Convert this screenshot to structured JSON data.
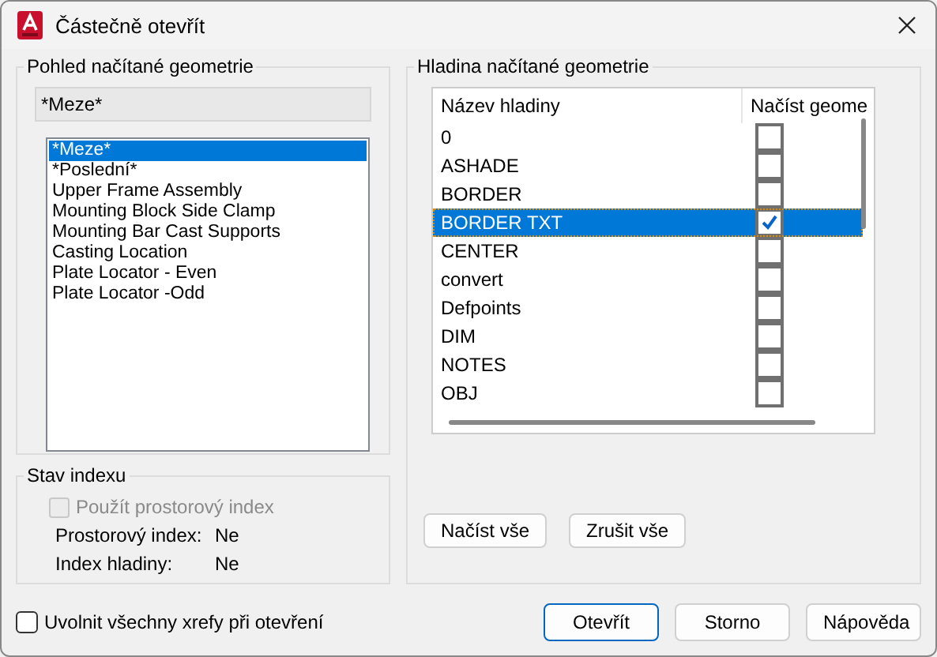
{
  "window": {
    "title": "Částečně otevřít"
  },
  "view_group": {
    "title": "Pohled načítané geometrie",
    "current": "*Meze*",
    "items": [
      {
        "label": "*Meze*",
        "selected": true
      },
      {
        "label": "*Poslední*",
        "selected": false
      },
      {
        "label": "Upper Frame Assembly",
        "selected": false
      },
      {
        "label": "Mounting Block Side Clamp",
        "selected": false
      },
      {
        "label": "Mounting Bar Cast Supports",
        "selected": false
      },
      {
        "label": "Casting Location",
        "selected": false
      },
      {
        "label": "Plate Locator - Even",
        "selected": false
      },
      {
        "label": "Plate Locator -Odd",
        "selected": false
      }
    ]
  },
  "index_group": {
    "title": "Stav indexu",
    "use_spatial": {
      "label": "Použít prostorový index",
      "checked": false,
      "disabled": true
    },
    "rows": [
      {
        "label": "Prostorový index:",
        "value": "Ne"
      },
      {
        "label": "Index hladiny:",
        "value": "Ne"
      }
    ]
  },
  "layer_group": {
    "title": "Hladina načítané geometrie",
    "columns": [
      "Název hladiny",
      "Načíst geome"
    ],
    "rows": [
      {
        "name": "0",
        "checked": false,
        "selected": false
      },
      {
        "name": "ASHADE",
        "checked": false,
        "selected": false
      },
      {
        "name": "BORDER",
        "checked": false,
        "selected": false
      },
      {
        "name": "BORDER TXT",
        "checked": true,
        "selected": true
      },
      {
        "name": "CENTER",
        "checked": false,
        "selected": false
      },
      {
        "name": "convert",
        "checked": false,
        "selected": false
      },
      {
        "name": "Defpoints",
        "checked": false,
        "selected": false
      },
      {
        "name": "DIM",
        "checked": false,
        "selected": false
      },
      {
        "name": "NOTES",
        "checked": false,
        "selected": false
      },
      {
        "name": "OBJ",
        "checked": false,
        "selected": false
      }
    ],
    "buttons": [
      "Načíst vše",
      "Zrušit vše"
    ]
  },
  "unload_xrefs": {
    "label": "Uvolnit všechny xrefy při otevření",
    "checked": false
  },
  "buttons": [
    {
      "label": "Otevřít",
      "default": true
    },
    {
      "label": "Storno",
      "default": false
    },
    {
      "label": "Nápověda",
      "default": false
    }
  ]
}
